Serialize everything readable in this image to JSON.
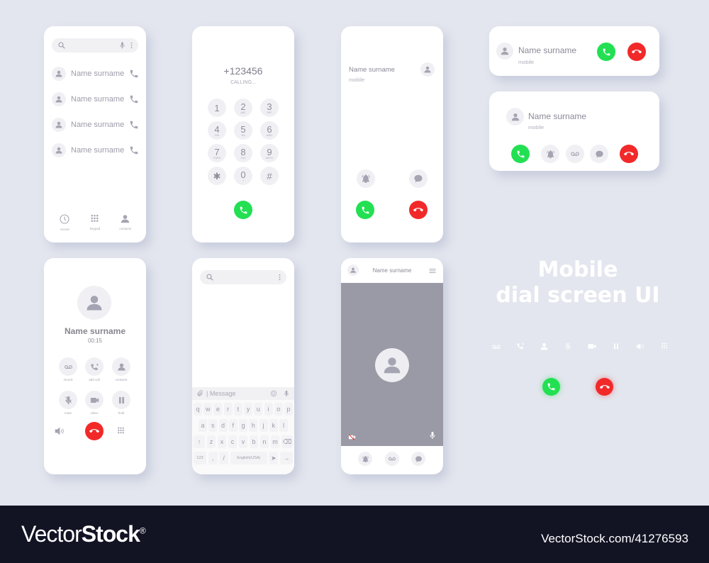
{
  "colors": {
    "accept": "#22e052",
    "decline": "#f22929",
    "icon": "#a4a4b2",
    "background": "#e3e6ee",
    "video_bg": "#9a9aa6",
    "footer": "#121424"
  },
  "contacts_screen": {
    "search_icon": "search-icon",
    "mic_icon": "mic-icon",
    "more_icon": "more-vert-icon",
    "contacts": [
      {
        "name": "Name surname"
      },
      {
        "name": "Name surname"
      },
      {
        "name": "Name surname"
      },
      {
        "name": "Name surname"
      }
    ],
    "nav": [
      {
        "label": "recent",
        "icon": "clock-icon"
      },
      {
        "label": "keypad",
        "icon": "keypad-icon"
      },
      {
        "label": "contacts",
        "icon": "person-icon"
      }
    ]
  },
  "dialer_screen": {
    "number": "+123456",
    "status": "CALLING...",
    "keys": [
      {
        "digit": "1",
        "letters": ""
      },
      {
        "digit": "2",
        "letters": "ABC"
      },
      {
        "digit": "3",
        "letters": "DEF"
      },
      {
        "digit": "4",
        "letters": "GHI"
      },
      {
        "digit": "5",
        "letters": "JKL"
      },
      {
        "digit": "6",
        "letters": "MNO"
      },
      {
        "digit": "7",
        "letters": "PQRS"
      },
      {
        "digit": "8",
        "letters": "TUV"
      },
      {
        "digit": "9",
        "letters": "WXYZ"
      },
      {
        "digit": "✱",
        "letters": ""
      },
      {
        "digit": "0",
        "letters": "+"
      },
      {
        "digit": "#",
        "letters": ""
      }
    ]
  },
  "incoming_screen": {
    "name": "Name surname",
    "type": "mobile"
  },
  "banner_small": {
    "name": "Name surname",
    "type": "mobile"
  },
  "banner_large": {
    "name": "Name surname",
    "type": "mobile"
  },
  "in_call_screen": {
    "name": "Name surname",
    "timer": "00:15",
    "controls": [
      {
        "label": "record",
        "icon": "voicemail-icon"
      },
      {
        "label": "add call",
        "icon": "add-call-icon"
      },
      {
        "label": "contacts",
        "icon": "person-icon"
      },
      {
        "label": "mute",
        "icon": "mic-off-icon"
      },
      {
        "label": "video",
        "icon": "video-icon"
      },
      {
        "label": "hold",
        "icon": "pause-icon"
      }
    ]
  },
  "message_screen": {
    "placeholder": "| Message",
    "rows": [
      [
        "q",
        "w",
        "e",
        "r",
        "t",
        "y",
        "u",
        "i",
        "o",
        "p"
      ],
      [
        "a",
        "s",
        "d",
        "f",
        "g",
        "h",
        "j",
        "k",
        "l"
      ],
      [
        "↑",
        "z",
        "x",
        "c",
        "v",
        "b",
        "n",
        "m",
        "⌫"
      ]
    ],
    "bottom": {
      "num": "123",
      "comma": ",",
      "slash": "/",
      "space": "English(USA)",
      "send": "➤",
      "enter": "→"
    }
  },
  "video_screen": {
    "name": "Name surname"
  },
  "title": {
    "line1": "Mobile",
    "line2": "dial screen UI"
  },
  "icon_strip": [
    "voicemail-icon",
    "add-call-icon",
    "person-icon",
    "mic-icon",
    "video-icon",
    "pause-icon",
    "speaker-icon",
    "keypad-icon"
  ],
  "footer": {
    "brand_light": "Vector",
    "brand_bold": "Stock",
    "reg": "®",
    "url": "VectorStock.com/41276593"
  }
}
